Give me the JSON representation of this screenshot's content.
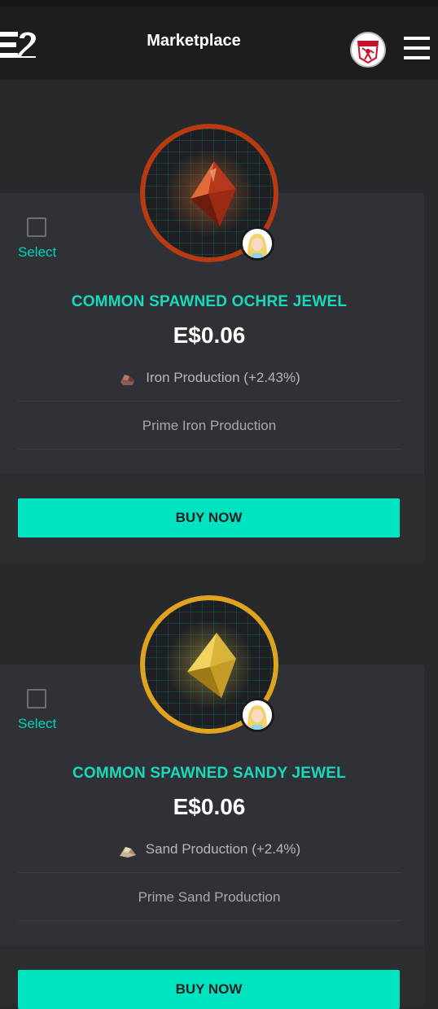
{
  "header": {
    "title": "Marketplace",
    "logo_icon": "e2-logo-icon",
    "avatar_icon": "america-club-badge-icon",
    "menu_icon": "hamburger-menu-icon"
  },
  "listings": [
    {
      "select_label": "Select",
      "title": "COMMON SPAWNED OCHRE JEWEL",
      "price": "E$0.06",
      "attribute": "Iron Production (+2.43%)",
      "attribute_icon": "iron-ore-icon",
      "prime": "Prime Iron Production",
      "buy_label": "BUY NOW",
      "ring_color": "#b83a10",
      "jewel_color": "#b5381b"
    },
    {
      "select_label": "Select",
      "title": "COMMON SPAWNED SANDY JEWEL",
      "price": "E$0.06",
      "attribute": "Sand Production (+2.4%)",
      "attribute_icon": "sand-pile-icon",
      "prime": "Prime Sand Production",
      "buy_label": "BUY NOW",
      "ring_color": "#e0a320",
      "jewel_color": "#e2bb3c"
    }
  ]
}
